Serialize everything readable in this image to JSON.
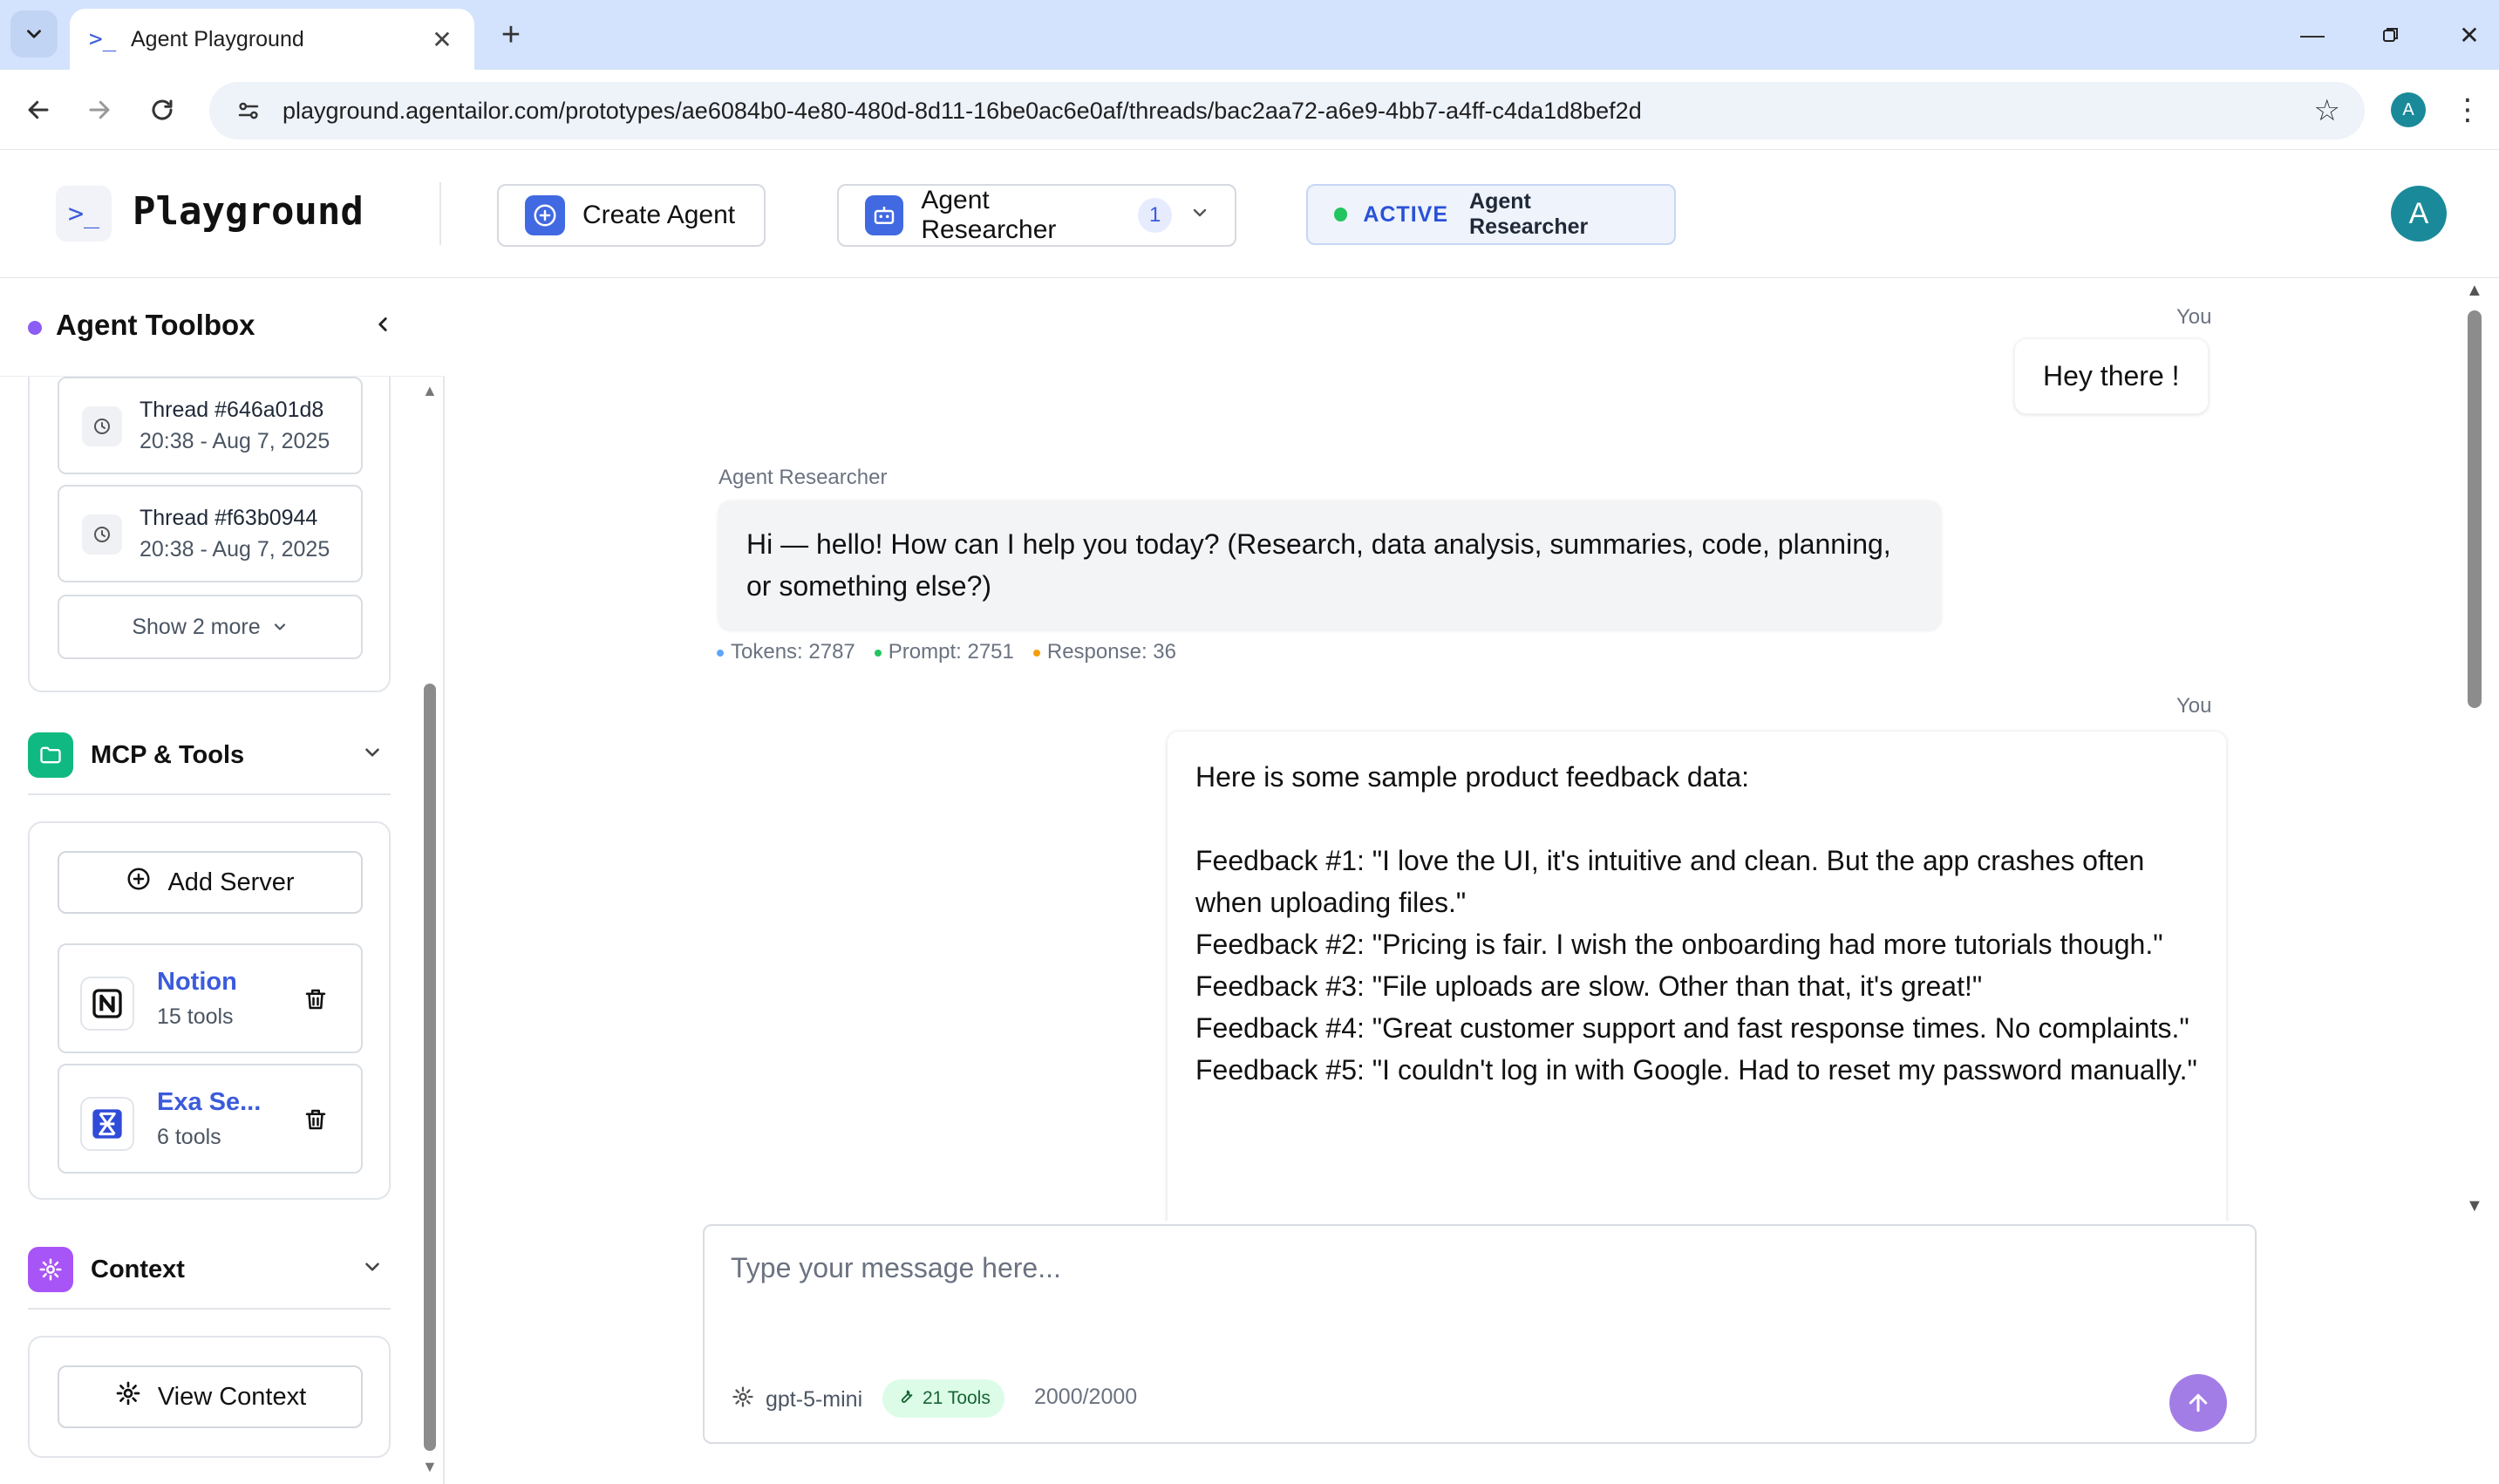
{
  "browser": {
    "tab_title": "Agent Playground",
    "tab_favicon": ">_",
    "url": "playground.agentailor.com/prototypes/ae6084b0-4e80-480d-8d11-16be0ac6e0af/threads/bac2aa72-a6e9-4bb7-a4ff-c4da1d8bef2d",
    "profile_initial": "A"
  },
  "header": {
    "logo_glyph": ">_",
    "logo_text": "Playground",
    "create_agent_label": "Create Agent",
    "agent_select_label": "Agent Researcher",
    "agent_select_count": "1",
    "status_label": "ACTIVE",
    "status_agent": "Agent Researcher",
    "status_color": "#22c55e",
    "avatar_initial": "A",
    "accent_color": "#4169e1"
  },
  "sidebar": {
    "title": "Agent Toolbox",
    "threads": [
      {
        "name": "Thread #646a01d8",
        "time": "20:38 - Aug 7, 2025"
      },
      {
        "name": "Thread #f63b0944",
        "time": "20:38 - Aug 7, 2025"
      }
    ],
    "show_more_label": "Show 2 more",
    "mcp_section": {
      "label": "MCP & Tools",
      "icon": "folder-icon",
      "color": "#10b981",
      "add_server_label": "Add Server",
      "servers": [
        {
          "name": "Notion",
          "tools": "15 tools",
          "icon": "notion-logo-icon"
        },
        {
          "name": "Exa Se...",
          "tools": "6 tools",
          "icon": "exa-logo-icon"
        }
      ]
    },
    "context_section": {
      "label": "Context",
      "icon": "gear-icon",
      "color": "#a855f7",
      "view_context_label": "View Context"
    }
  },
  "chat": {
    "messages": [
      {
        "role": "You",
        "text": "Hey there !"
      },
      {
        "role": "Agent Researcher",
        "text": "Hi — hello! How can I help you today? (Research, data analysis, summaries, code, planning, or something else?)",
        "stats": {
          "tokens": "Tokens: 2787",
          "prompt": "Prompt: 2751",
          "response": "Response: 36"
        }
      },
      {
        "role": "You",
        "lines": [
          "Here is some sample product feedback data:",
          "",
          "Feedback #1: \"I love the UI, it's intuitive and clean. But the app crashes often when uploading files.\"",
          "Feedback #2: \"Pricing is fair. I wish the onboarding had more tutorials though.\"",
          "Feedback #3: \"File uploads are slow. Other than that, it's great!\"",
          "Feedback #4: \"Great customer support and fast response times. No complaints.\"",
          "Feedback #5: \"I couldn't log in with Google. Had to reset my password manually.\""
        ]
      }
    ]
  },
  "composer": {
    "placeholder": "Type your message here...",
    "value": "",
    "model": "gpt-5-mini",
    "tools_badge": "21 Tools",
    "char_counter": "2000/2000",
    "send_color": "#a37de6"
  }
}
